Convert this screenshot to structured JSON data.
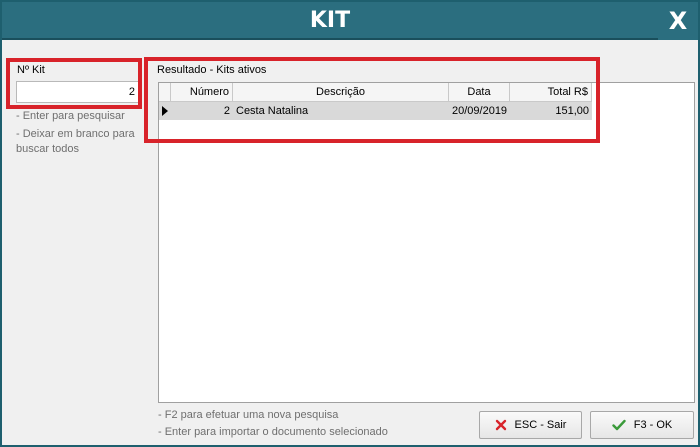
{
  "window": {
    "title": "KIT",
    "close_label": "X"
  },
  "kit": {
    "label": "Nº Kit",
    "value": "2",
    "hints": [
      "- Enter para pesquisar",
      "- Deixar em branco para buscar todos"
    ]
  },
  "results": {
    "label": "Resultado - Kits ativos",
    "columns": [
      "Número",
      "Descrição",
      "Data",
      "Total R$"
    ],
    "rows": [
      {
        "numero": "2",
        "descricao": "Cesta Natalina",
        "data": "20/09/2019",
        "total": "151,00"
      }
    ]
  },
  "footer": {
    "hints": [
      "- F2 para efetuar uma nova pesquisa",
      "- Enter para importar o documento selecionado"
    ],
    "esc_label": "ESC - Sair",
    "ok_label": "F3 - OK"
  },
  "colors": {
    "titlebar": "#2b6e7f",
    "highlight": "#d8232a",
    "row_selected": "#d9d9d9"
  }
}
